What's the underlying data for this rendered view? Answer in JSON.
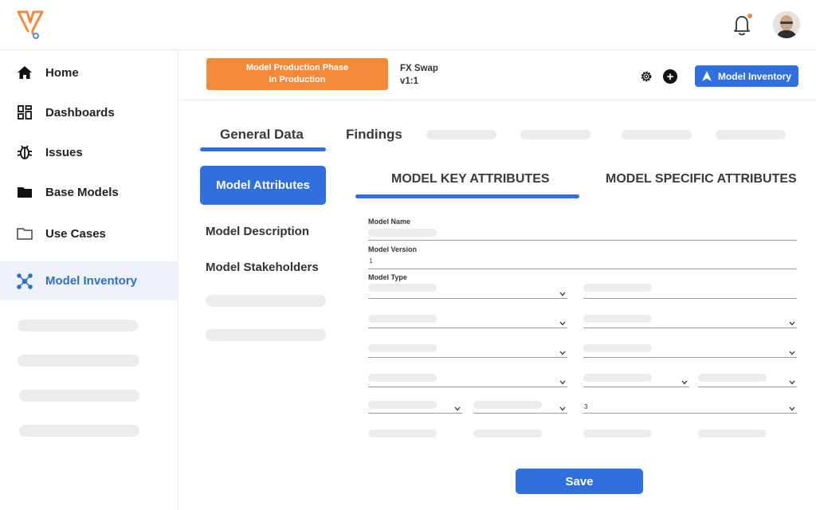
{
  "nav": {
    "items": [
      {
        "label": "Home",
        "icon": "home-icon"
      },
      {
        "label": "Dashboards",
        "icon": "dashboard-grid-icon"
      },
      {
        "label": "Issues",
        "icon": "bug-icon"
      },
      {
        "label": "Base Models",
        "icon": "folder-filled-icon"
      },
      {
        "label": "Use Cases",
        "icon": "folder-outline-icon"
      },
      {
        "label": "Model Inventory",
        "icon": "network-icon"
      }
    ],
    "active_color": "#2f6fc4"
  },
  "header": {
    "phase_line1": "Model Production Phase",
    "phase_line2": "in Production",
    "model_name": "FX Swap",
    "model_version": "v1:1",
    "inventory_button": "Model Inventory"
  },
  "tabs": {
    "general": "General Data",
    "findings": "Findings"
  },
  "submenu": {
    "active": "Model Attributes",
    "description": "Model Description",
    "stakeholders": "Model Stakeholders"
  },
  "attr_tabs": {
    "key": "MODEL KEY ATTRIBUTES",
    "specific": "MODEL SPECIFIC ATTRIBUTES"
  },
  "form": {
    "model_name_label": "Model Name",
    "model_version_label": "Model Version",
    "model_version_value": "1",
    "model_type_label": "Model Type",
    "row5_value": "3"
  },
  "save_label": "Save",
  "colors": {
    "primary": "#2f6fde",
    "phase_badge": "#f28a3a",
    "logo": "#f28a3a",
    "notification_dot": "#f28a3a"
  }
}
